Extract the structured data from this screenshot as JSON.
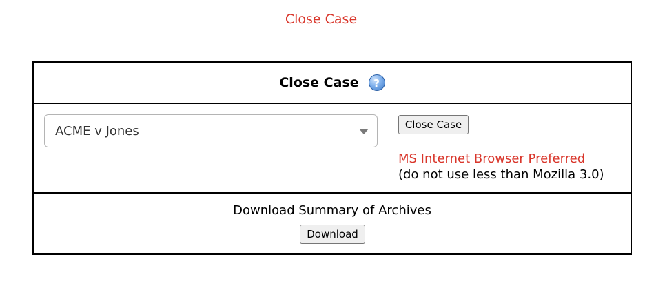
{
  "page": {
    "title": "Close Case"
  },
  "panel": {
    "title": "Close Case",
    "help_icon": "help-icon",
    "help_glyph": "?"
  },
  "case_select": {
    "selected_value": "ACME v Jones",
    "icon": "chevron-down-icon"
  },
  "close_button": {
    "label": "Close Case"
  },
  "browser_note": {
    "line1": "MS Internet Browser Preferred",
    "line2": "(do not use less than Mozilla 3.0)"
  },
  "download": {
    "label": "Download Summary of Archives",
    "button_label": "Download"
  },
  "colors": {
    "accent_red": "#d9362b",
    "border": "#000000",
    "help_icon_blue": "#3f7cc9"
  }
}
